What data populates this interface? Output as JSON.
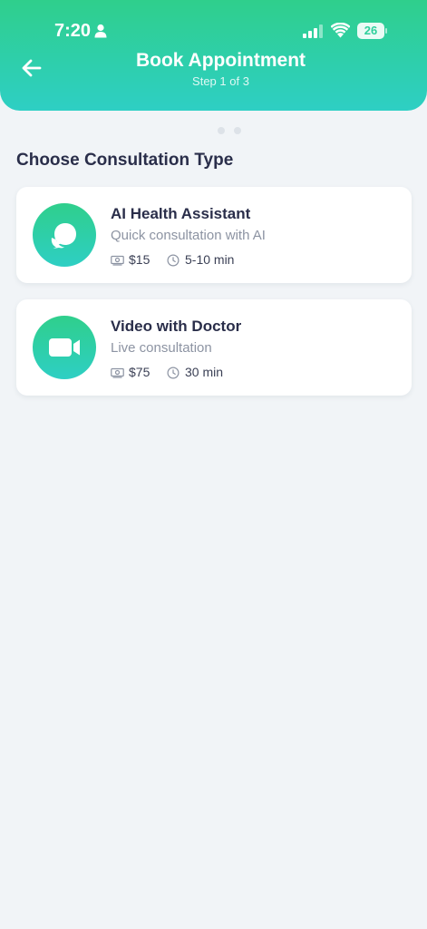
{
  "status_bar": {
    "time": "7:20",
    "battery": "26"
  },
  "header": {
    "title": "Book Appointment",
    "subtitle": "Step 1 of 3"
  },
  "section_title": "Choose Consultation Type",
  "cards": [
    {
      "title": "AI Health Assistant",
      "description": "Quick consultation with AI",
      "price": "$15",
      "duration": "5-10 min",
      "icon": "chat-bubbles-icon"
    },
    {
      "title": "Video with Doctor",
      "description": "Live consultation",
      "price": "$75",
      "duration": "30 min",
      "icon": "video-camera-icon"
    }
  ],
  "colors": {
    "accent_top": "#2fcf8c",
    "accent_bottom": "#2ecfc4",
    "background": "#f1f4f7",
    "text_dark": "#2a2e4a",
    "text_muted": "#8c93a2"
  }
}
